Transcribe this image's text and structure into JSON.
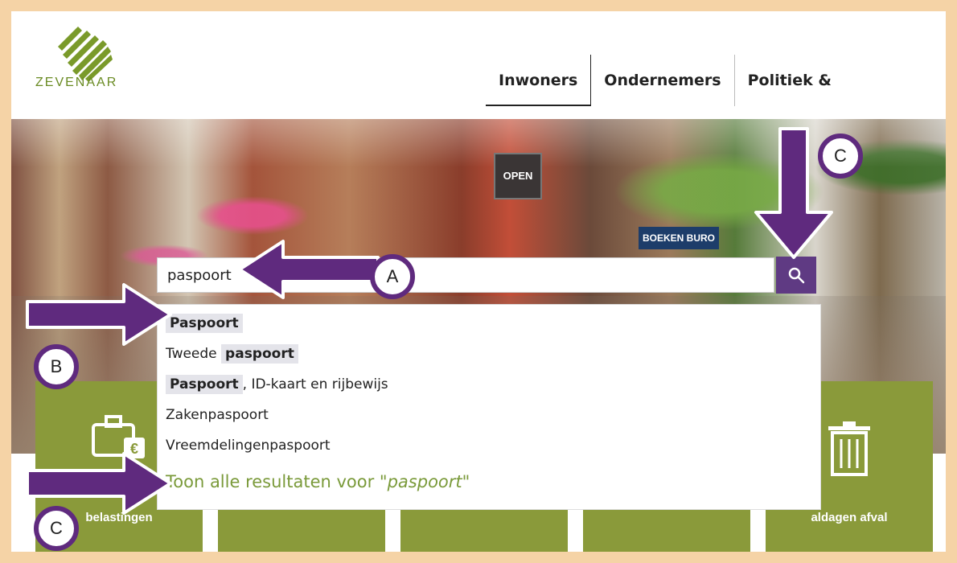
{
  "logo": {
    "text": "ZEVENAAR"
  },
  "nav": {
    "items": [
      {
        "label": "Inwoners"
      },
      {
        "label": "Ondernemers"
      },
      {
        "label": "Politiek & Organisatie"
      }
    ]
  },
  "hero": {
    "open_sign": "OPEN",
    "shop_sign": "BOEKEN BURO"
  },
  "search": {
    "value": "paspoort",
    "button_icon": "search-icon"
  },
  "suggestions": {
    "items": [
      {
        "pre": "",
        "highlight": "Paspoort",
        "post": ""
      },
      {
        "pre": "Tweede ",
        "highlight": "paspoort",
        "post": ""
      },
      {
        "pre": "",
        "highlight": "Paspoort",
        "post": ", ID-kaart en rijbewijs"
      },
      {
        "pre": "Zakenpaspoort",
        "highlight": "",
        "post": ""
      },
      {
        "pre": "Vreemdelingenpaspoort",
        "highlight": "",
        "post": ""
      }
    ],
    "show_all_prefix": "Toon alle resultaten voor \"",
    "show_all_term": "paspoort",
    "show_all_suffix": "\""
  },
  "tiles": [
    {
      "label": "belastingen",
      "icon": "briefcase-euro-icon"
    },
    {
      "label": ""
    },
    {
      "label": ""
    },
    {
      "label": ""
    },
    {
      "label": "aldagen afval",
      "icon": "trash-icon"
    }
  ],
  "annotations": {
    "a": "A",
    "b": "B",
    "c1": "C",
    "c2": "C"
  },
  "colors": {
    "accent": "#5f3a83",
    "brand_green": "#7a9a3a",
    "tile_green": "#8a9a3a",
    "frame": "#f5d3a6"
  }
}
